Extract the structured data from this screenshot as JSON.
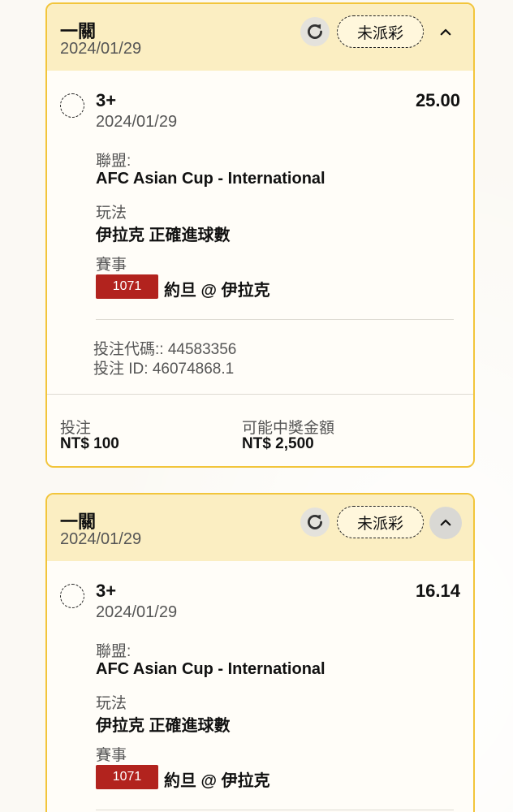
{
  "bets": [
    {
      "type": "一關",
      "date": "2024/01/29",
      "status": "未派彩",
      "selection": "3+",
      "selection_date": "2024/01/29",
      "odds": "25.00",
      "league_label": "聯盟:",
      "league": "AFC Asian Cup - International",
      "market_label": "玩法",
      "market": "伊拉克 正確進球數",
      "event_label": "賽事",
      "match_no": "1071",
      "match": "約旦 @ 伊拉克",
      "bet_code": "投注代碼:: 44583356",
      "bet_id": "投注 ID: 46074868.1",
      "stake_label": "投注",
      "stake": "NT$ 100",
      "payout_label": "可能中獎金額",
      "payout": "NT$ 2,500"
    },
    {
      "type": "一關",
      "date": "2024/01/29",
      "status": "未派彩",
      "selection": "3+",
      "selection_date": "2024/01/29",
      "odds": "16.14",
      "league_label": "聯盟:",
      "league": "AFC Asian Cup - International",
      "market_label": "玩法",
      "market": "伊拉克 正確進球數",
      "event_label": "賽事",
      "match_no": "1071",
      "match": "約旦 @ 伊拉克"
    }
  ],
  "colors": {
    "accent_border": "#f2c53b",
    "header_bg": "#fbeec2",
    "badge_red": "#b2231e"
  },
  "icons": {
    "refresh": "refresh-icon",
    "chevron": "chevron-up-icon",
    "radio": "radio-unchecked-icon"
  }
}
